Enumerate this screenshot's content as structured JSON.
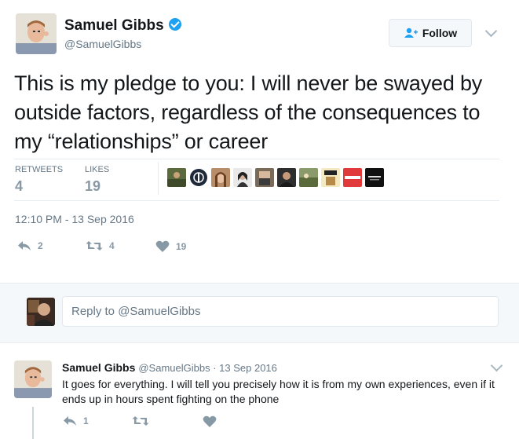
{
  "tweet": {
    "author_name": "Samuel Gibbs",
    "author_handle": "@SamuelGibbs",
    "follow_label": "Follow",
    "text": "This is my pledge to you: I will never be swayed by outside factors, regardless of the consequences to my “relationships” or career",
    "retweets_label": "RETWEETS",
    "retweets_count": "4",
    "likes_label": "LIKES",
    "likes_count": "19",
    "timestamp": "12:10 PM - 13 Sep 2016",
    "actions": {
      "reply_count": "2",
      "retweet_count": "4",
      "like_count": "19"
    },
    "likers": [
      "liker-1",
      "liker-2",
      "liker-3",
      "liker-4",
      "liker-5",
      "liker-6",
      "liker-7",
      "liker-8",
      "liker-9",
      "liker-10"
    ]
  },
  "reply_box": {
    "placeholder": "Reply to @SamuelGibbs"
  },
  "reply": {
    "author_name": "Samuel Gibbs",
    "meta": "@SamuelGibbs · 13 Sep 2016",
    "text": "It goes for everything. I will tell you precisely how it is from my own experiences, even if it ends up in hours spent fighting on the phone",
    "reply_count": "1"
  },
  "colors": {
    "accent": "#1da1f2",
    "text": "#14171a",
    "muted": "#657786",
    "icon": "#8899a6",
    "divider": "#e6ecf0"
  },
  "icons": [
    "verified-badge-icon",
    "follow-user-icon",
    "chevron-down-icon",
    "reply-icon",
    "retweet-icon",
    "heart-icon"
  ]
}
